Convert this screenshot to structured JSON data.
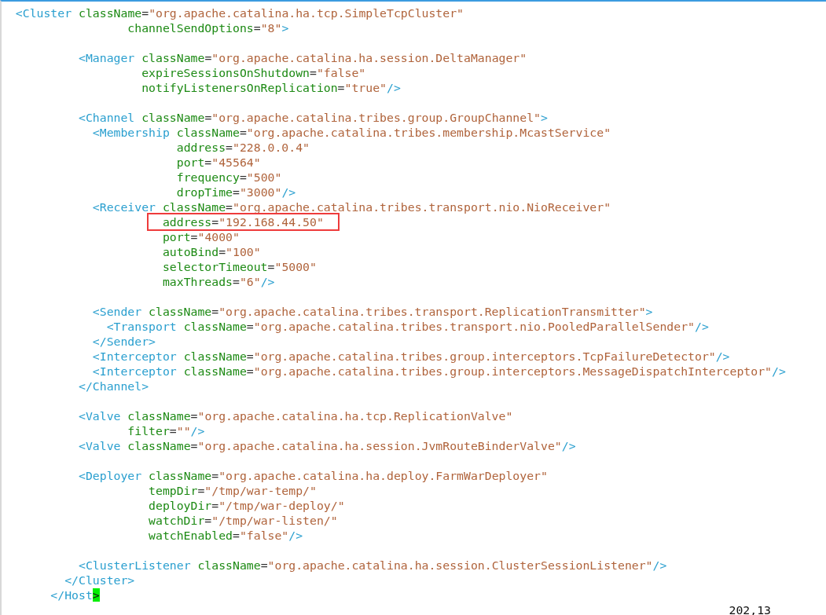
{
  "lines": [
    {
      "kind": "code",
      "tokens": [
        {
          "kind": "tag",
          "text": "  <Cluster"
        },
        {
          "kind": "attr",
          "text": " className"
        },
        {
          "kind": "punct",
          "text": "="
        },
        {
          "kind": "value",
          "text": "\"org.apache.catalina.ha.tcp.SimpleTcpCluster\""
        }
      ]
    },
    {
      "kind": "code",
      "tokens": [
        {
          "kind": "attr",
          "text": "                  channelSendOptions"
        },
        {
          "kind": "punct",
          "text": "="
        },
        {
          "kind": "value",
          "text": "\"8\""
        },
        {
          "kind": "tag",
          "text": ">"
        }
      ]
    },
    {
      "kind": "blank"
    },
    {
      "kind": "code",
      "tokens": [
        {
          "kind": "tag",
          "text": "           <Manager"
        },
        {
          "kind": "attr",
          "text": " className"
        },
        {
          "kind": "punct",
          "text": "="
        },
        {
          "kind": "value",
          "text": "\"org.apache.catalina.ha.session.DeltaManager\""
        }
      ]
    },
    {
      "kind": "code",
      "tokens": [
        {
          "kind": "attr",
          "text": "                    expireSessionsOnShutdown"
        },
        {
          "kind": "punct",
          "text": "="
        },
        {
          "kind": "value",
          "text": "\"false\""
        }
      ]
    },
    {
      "kind": "code",
      "tokens": [
        {
          "kind": "attr",
          "text": "                    notifyListenersOnReplication"
        },
        {
          "kind": "punct",
          "text": "="
        },
        {
          "kind": "value",
          "text": "\"true\""
        },
        {
          "kind": "tag",
          "text": "/>"
        }
      ]
    },
    {
      "kind": "blank"
    },
    {
      "kind": "code",
      "tokens": [
        {
          "kind": "tag",
          "text": "           <Channel"
        },
        {
          "kind": "attr",
          "text": " className"
        },
        {
          "kind": "punct",
          "text": "="
        },
        {
          "kind": "value",
          "text": "\"org.apache.catalina.tribes.group.GroupChannel\""
        },
        {
          "kind": "tag",
          "text": ">"
        }
      ]
    },
    {
      "kind": "code",
      "tokens": [
        {
          "kind": "tag",
          "text": "             <Membership"
        },
        {
          "kind": "attr",
          "text": " className"
        },
        {
          "kind": "punct",
          "text": "="
        },
        {
          "kind": "value",
          "text": "\"org.apache.catalina.tribes.membership.McastService\""
        }
      ]
    },
    {
      "kind": "code",
      "tokens": [
        {
          "kind": "attr",
          "text": "                         address"
        },
        {
          "kind": "punct",
          "text": "="
        },
        {
          "kind": "value",
          "text": "\"228.0.0.4\""
        }
      ]
    },
    {
      "kind": "code",
      "tokens": [
        {
          "kind": "attr",
          "text": "                         port"
        },
        {
          "kind": "punct",
          "text": "="
        },
        {
          "kind": "value",
          "text": "\"45564\""
        }
      ]
    },
    {
      "kind": "code",
      "tokens": [
        {
          "kind": "attr",
          "text": "                         frequency"
        },
        {
          "kind": "punct",
          "text": "="
        },
        {
          "kind": "value",
          "text": "\"500\""
        }
      ]
    },
    {
      "kind": "code",
      "tokens": [
        {
          "kind": "attr",
          "text": "                         dropTime"
        },
        {
          "kind": "punct",
          "text": "="
        },
        {
          "kind": "value",
          "text": "\"3000\""
        },
        {
          "kind": "tag",
          "text": "/>"
        }
      ]
    },
    {
      "kind": "code",
      "tokens": [
        {
          "kind": "tag",
          "text": "             <Receiver"
        },
        {
          "kind": "attr",
          "text": " className"
        },
        {
          "kind": "punct",
          "text": "="
        },
        {
          "kind": "value",
          "text": "\"org.apache.catalina.tribes.transport.nio.NioReceiver\""
        }
      ]
    },
    {
      "kind": "code",
      "highlighted": true,
      "tokens": [
        {
          "kind": "attr",
          "text": "                       address"
        },
        {
          "kind": "punct",
          "text": "="
        },
        {
          "kind": "value",
          "text": "\"192.168.44.50\""
        }
      ]
    },
    {
      "kind": "code",
      "tokens": [
        {
          "kind": "attr",
          "text": "                       port"
        },
        {
          "kind": "punct",
          "text": "="
        },
        {
          "kind": "value",
          "text": "\"4000\""
        }
      ]
    },
    {
      "kind": "code",
      "tokens": [
        {
          "kind": "attr",
          "text": "                       autoBind"
        },
        {
          "kind": "punct",
          "text": "="
        },
        {
          "kind": "value",
          "text": "\"100\""
        }
      ]
    },
    {
      "kind": "code",
      "tokens": [
        {
          "kind": "attr",
          "text": "                       selectorTimeout"
        },
        {
          "kind": "punct",
          "text": "="
        },
        {
          "kind": "value",
          "text": "\"5000\""
        }
      ]
    },
    {
      "kind": "code",
      "tokens": [
        {
          "kind": "attr",
          "text": "                       maxThreads"
        },
        {
          "kind": "punct",
          "text": "="
        },
        {
          "kind": "value",
          "text": "\"6\""
        },
        {
          "kind": "tag",
          "text": "/>"
        }
      ]
    },
    {
      "kind": "blank"
    },
    {
      "kind": "code",
      "tokens": [
        {
          "kind": "tag",
          "text": "             <Sender"
        },
        {
          "kind": "attr",
          "text": " className"
        },
        {
          "kind": "punct",
          "text": "="
        },
        {
          "kind": "value",
          "text": "\"org.apache.catalina.tribes.transport.ReplicationTransmitter\""
        },
        {
          "kind": "tag",
          "text": ">"
        }
      ]
    },
    {
      "kind": "code",
      "tokens": [
        {
          "kind": "tag",
          "text": "               <Transport"
        },
        {
          "kind": "attr",
          "text": " className"
        },
        {
          "kind": "punct",
          "text": "="
        },
        {
          "kind": "value",
          "text": "\"org.apache.catalina.tribes.transport.nio.PooledParallelSender\""
        },
        {
          "kind": "tag",
          "text": "/>"
        }
      ]
    },
    {
      "kind": "code",
      "tokens": [
        {
          "kind": "tag",
          "text": "             </Sender>"
        }
      ]
    },
    {
      "kind": "code",
      "tokens": [
        {
          "kind": "tag",
          "text": "             <Interceptor"
        },
        {
          "kind": "attr",
          "text": " className"
        },
        {
          "kind": "punct",
          "text": "="
        },
        {
          "kind": "value",
          "text": "\"org.apache.catalina.tribes.group.interceptors.TcpFailureDetector\""
        },
        {
          "kind": "tag",
          "text": "/>"
        }
      ]
    },
    {
      "kind": "code",
      "tokens": [
        {
          "kind": "tag",
          "text": "             <Interceptor"
        },
        {
          "kind": "attr",
          "text": " className"
        },
        {
          "kind": "punct",
          "text": "="
        },
        {
          "kind": "value",
          "text": "\"org.apache.catalina.tribes.group.interceptors.MessageDispatchInterceptor\""
        },
        {
          "kind": "tag",
          "text": "/>"
        }
      ]
    },
    {
      "kind": "code",
      "tokens": [
        {
          "kind": "tag",
          "text": "           </Channel>"
        }
      ]
    },
    {
      "kind": "blank"
    },
    {
      "kind": "code",
      "tokens": [
        {
          "kind": "tag",
          "text": "           <Valve"
        },
        {
          "kind": "attr",
          "text": " className"
        },
        {
          "kind": "punct",
          "text": "="
        },
        {
          "kind": "value",
          "text": "\"org.apache.catalina.ha.tcp.ReplicationValve\""
        }
      ]
    },
    {
      "kind": "code",
      "tokens": [
        {
          "kind": "attr",
          "text": "                  filter"
        },
        {
          "kind": "punct",
          "text": "="
        },
        {
          "kind": "value",
          "text": "\"\""
        },
        {
          "kind": "tag",
          "text": "/>"
        }
      ]
    },
    {
      "kind": "code",
      "tokens": [
        {
          "kind": "tag",
          "text": "           <Valve"
        },
        {
          "kind": "attr",
          "text": " className"
        },
        {
          "kind": "punct",
          "text": "="
        },
        {
          "kind": "value",
          "text": "\"org.apache.catalina.ha.session.JvmRouteBinderValve\""
        },
        {
          "kind": "tag",
          "text": "/>"
        }
      ]
    },
    {
      "kind": "blank"
    },
    {
      "kind": "code",
      "tokens": [
        {
          "kind": "tag",
          "text": "           <Deployer"
        },
        {
          "kind": "attr",
          "text": " className"
        },
        {
          "kind": "punct",
          "text": "="
        },
        {
          "kind": "value",
          "text": "\"org.apache.catalina.ha.deploy.FarmWarDeployer\""
        }
      ]
    },
    {
      "kind": "code",
      "tokens": [
        {
          "kind": "attr",
          "text": "                     tempDir"
        },
        {
          "kind": "punct",
          "text": "="
        },
        {
          "kind": "value",
          "text": "\"/tmp/war-temp/\""
        }
      ]
    },
    {
      "kind": "code",
      "tokens": [
        {
          "kind": "attr",
          "text": "                     deployDir"
        },
        {
          "kind": "punct",
          "text": "="
        },
        {
          "kind": "value",
          "text": "\"/tmp/war-deploy/\""
        }
      ]
    },
    {
      "kind": "code",
      "tokens": [
        {
          "kind": "attr",
          "text": "                     watchDir"
        },
        {
          "kind": "punct",
          "text": "="
        },
        {
          "kind": "value",
          "text": "\"/tmp/war-listen/\""
        }
      ]
    },
    {
      "kind": "code",
      "tokens": [
        {
          "kind": "attr",
          "text": "                     watchEnabled"
        },
        {
          "kind": "punct",
          "text": "="
        },
        {
          "kind": "value",
          "text": "\"false\""
        },
        {
          "kind": "tag",
          "text": "/>"
        }
      ]
    },
    {
      "kind": "blank"
    },
    {
      "kind": "code",
      "tokens": [
        {
          "kind": "tag",
          "text": "           <ClusterListener"
        },
        {
          "kind": "attr",
          "text": " className"
        },
        {
          "kind": "punct",
          "text": "="
        },
        {
          "kind": "value",
          "text": "\"org.apache.catalina.ha.session.ClusterSessionListener\""
        },
        {
          "kind": "tag",
          "text": "/>"
        }
      ]
    },
    {
      "kind": "code",
      "tokens": [
        {
          "kind": "tag",
          "text": "         </Cluster>"
        }
      ]
    },
    {
      "kind": "code",
      "tokens": [
        {
          "kind": "tag",
          "text": "       </Host"
        },
        {
          "kind": "cursor",
          "text": ">"
        }
      ]
    }
  ],
  "status_bar": {
    "ruler": "202,13"
  }
}
